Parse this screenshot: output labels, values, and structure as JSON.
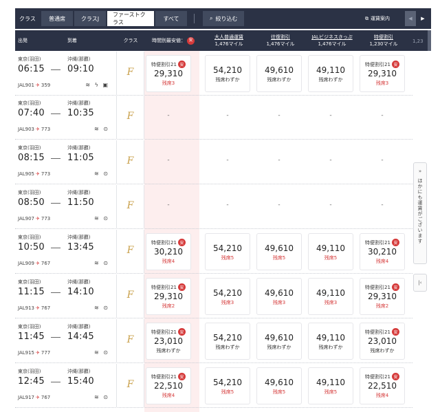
{
  "toolbar": {
    "label": "クラス",
    "segments": [
      "普通席",
      "クラスJ",
      "ファーストクラス",
      "すべて"
    ],
    "filter": "絞り込む",
    "fare_info": "運賃案内"
  },
  "header": {
    "depart": "出発",
    "arrive": "到着",
    "class": "クラス",
    "special": "時間別最安値",
    "safe_badge": "安",
    "fares": [
      {
        "name": "大人普通運賃",
        "miles": "1,476マイル"
      },
      {
        "name": "往復割引",
        "miles": "1,476マイル"
      },
      {
        "name": "JALビジネスきっぷ",
        "miles": "1,476マイル"
      },
      {
        "name": "特便割引",
        "miles": "1,230マイル"
      }
    ],
    "cut_off": "1,23"
  },
  "side_panel": {
    "text": "ほかにも運賃がございます"
  },
  "flights": [
    {
      "from": "東京(羽田)",
      "to": "沖縄(那覇)",
      "dep": "06:15",
      "arr": "09:10",
      "no": "JAL901",
      "aircraft": "359",
      "amenity": "≋ ϟ ▣",
      "fares": [
        {
          "name": "特便割引21",
          "price": "29,310",
          "seats": "残席3",
          "seat_style": "red"
        },
        {
          "name": "",
          "price": "54,210",
          "seats": "残席わずか",
          "seat_style": "blk"
        },
        {
          "name": "",
          "price": "49,610",
          "seats": "残席わずか",
          "seat_style": "blk"
        },
        {
          "name": "",
          "price": "49,110",
          "seats": "残席わずか",
          "seat_style": "blk"
        },
        {
          "name": "特便割引21",
          "price": "29,310",
          "seats": "残席3",
          "seat_style": "red"
        }
      ]
    },
    {
      "from": "東京(羽田)",
      "to": "沖縄(那覇)",
      "dep": "07:40",
      "arr": "10:35",
      "no": "JAL903",
      "aircraft": "773",
      "amenity": "≋ ⊙",
      "empty": "-"
    },
    {
      "from": "東京(羽田)",
      "to": "沖縄(那覇)",
      "dep": "08:15",
      "arr": "11:05",
      "no": "JAL905",
      "aircraft": "773",
      "amenity": "≋ ⊙",
      "empty": "-"
    },
    {
      "from": "東京(羽田)",
      "to": "沖縄(那覇)",
      "dep": "08:50",
      "arr": "11:50",
      "no": "JAL907",
      "aircraft": "773",
      "amenity": "≋ ⊙",
      "empty": "-"
    },
    {
      "from": "東京(羽田)",
      "to": "沖縄(那覇)",
      "dep": "10:50",
      "arr": "13:45",
      "no": "JAL909",
      "aircraft": "767",
      "amenity": "≋ ⊙",
      "fares": [
        {
          "name": "特便割引21",
          "price": "30,210",
          "seats": "残席4",
          "seat_style": "red"
        },
        {
          "name": "",
          "price": "54,210",
          "seats": "残席5",
          "seat_style": "red"
        },
        {
          "name": "",
          "price": "49,610",
          "seats": "残席5",
          "seat_style": "red"
        },
        {
          "name": "",
          "price": "49,110",
          "seats": "残席5",
          "seat_style": "red"
        },
        {
          "name": "特便割引21",
          "price": "30,210",
          "seats": "残席4",
          "seat_style": "red"
        }
      ]
    },
    {
      "from": "東京(羽田)",
      "to": "沖縄(那覇)",
      "dep": "11:15",
      "arr": "14:10",
      "no": "JAL913",
      "aircraft": "767",
      "amenity": "≋ ⊙",
      "fares": [
        {
          "name": "特便割引21",
          "price": "29,310",
          "seats": "残席2",
          "seat_style": "red"
        },
        {
          "name": "",
          "price": "54,210",
          "seats": "残席3",
          "seat_style": "red"
        },
        {
          "name": "",
          "price": "49,610",
          "seats": "残席3",
          "seat_style": "red"
        },
        {
          "name": "",
          "price": "49,110",
          "seats": "残席3",
          "seat_style": "red"
        },
        {
          "name": "特便割引21",
          "price": "29,310",
          "seats": "残席2",
          "seat_style": "red"
        }
      ]
    },
    {
      "from": "東京(羽田)",
      "to": "沖縄(那覇)",
      "dep": "11:45",
      "arr": "14:45",
      "no": "JAL915",
      "aircraft": "777",
      "amenity": "≋ ⊙",
      "fares": [
        {
          "name": "特便割引21",
          "price": "23,010",
          "seats": "残席わずか",
          "seat_style": "blk"
        },
        {
          "name": "",
          "price": "54,210",
          "seats": "残席わずか",
          "seat_style": "blk"
        },
        {
          "name": "",
          "price": "49,610",
          "seats": "残席わずか",
          "seat_style": "blk"
        },
        {
          "name": "",
          "price": "49,110",
          "seats": "残席わずか",
          "seat_style": "blk"
        },
        {
          "name": "特便割引21",
          "price": "23,010",
          "seats": "残席わずか",
          "seat_style": "blk"
        }
      ]
    },
    {
      "from": "東京(羽田)",
      "to": "沖縄(那覇)",
      "dep": "12:45",
      "arr": "15:40",
      "no": "JAL917",
      "aircraft": "767",
      "amenity": "≋ ⊙",
      "fares": [
        {
          "name": "特便割引21",
          "price": "22,510",
          "seats": "残席4",
          "seat_style": "red"
        },
        {
          "name": "",
          "price": "54,210",
          "seats": "残席5",
          "seat_style": "red"
        },
        {
          "name": "",
          "price": "49,610",
          "seats": "残席5",
          "seat_style": "red"
        },
        {
          "name": "",
          "price": "49,110",
          "seats": "残席5",
          "seat_style": "red"
        },
        {
          "name": "特便割引21",
          "price": "22,510",
          "seats": "残席4",
          "seat_style": "red"
        }
      ]
    }
  ]
}
